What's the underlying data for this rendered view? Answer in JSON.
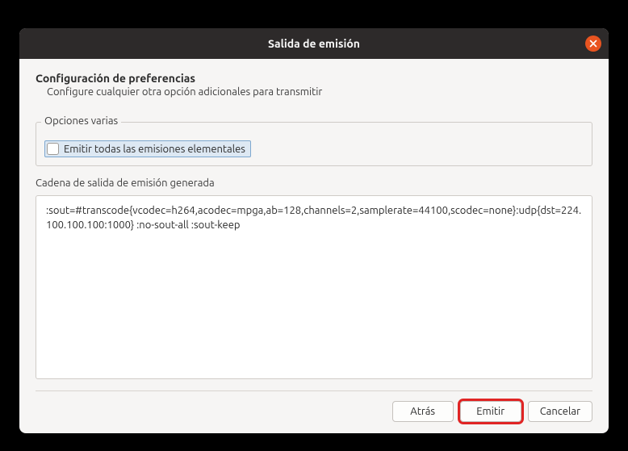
{
  "window": {
    "title": "Salida de emisión"
  },
  "header": {
    "title": "Configuración de preferencias",
    "subtitle": "Configure cualquier otra opción adicionales para transmitir"
  },
  "misc": {
    "group_label": "Opciones varias",
    "emit_all_label": "Emitir todas las emisiones elementales",
    "emit_all_checked": false
  },
  "generated": {
    "label": "Cadena de salida de emisión generada",
    "value": ":sout=#transcode{vcodec=h264,acodec=mpga,ab=128,channels=2,samplerate=44100,scodec=none}:udp{dst=224.100.100.100:1000} :no-sout-all :sout-keep"
  },
  "buttons": {
    "back": "Atrás",
    "emit": "Emitir",
    "cancel": "Cancelar"
  }
}
